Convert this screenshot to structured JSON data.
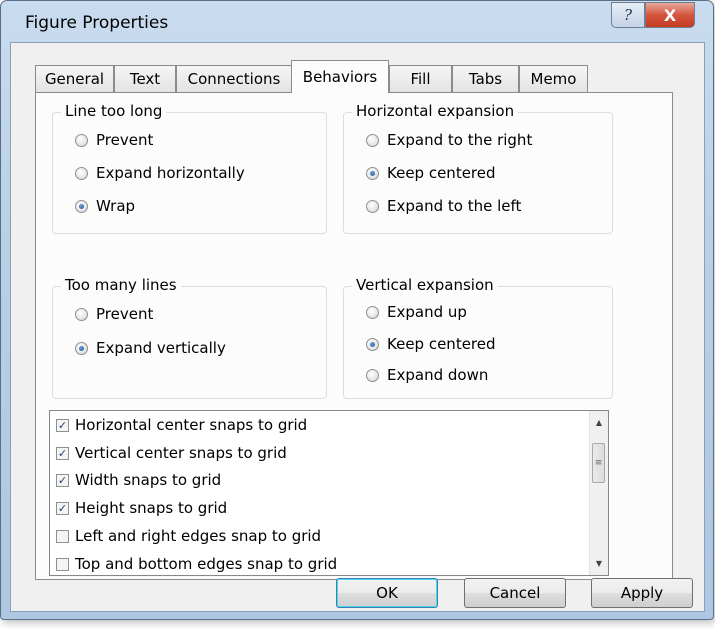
{
  "window": {
    "title": "Figure Properties",
    "help_glyph": "?",
    "close_glyph": "X"
  },
  "tabs": [
    {
      "label": "General"
    },
    {
      "label": "Text"
    },
    {
      "label": "Connections"
    },
    {
      "label": "Behaviors",
      "active": true
    },
    {
      "label": "Fill"
    },
    {
      "label": "Tabs"
    },
    {
      "label": "Memo"
    }
  ],
  "groups": {
    "line_too_long": {
      "title": "Line too long",
      "options": [
        "Prevent",
        "Expand horizontally",
        "Wrap"
      ],
      "selected": "Wrap"
    },
    "horizontal_expansion": {
      "title": "Horizontal expansion",
      "options": [
        "Expand to the right",
        "Keep centered",
        "Expand to the left"
      ],
      "selected": "Keep centered"
    },
    "too_many_lines": {
      "title": "Too many lines",
      "options": [
        "Prevent",
        "Expand vertically"
      ],
      "selected": "Expand vertically"
    },
    "vertical_expansion": {
      "title": "Vertical expansion",
      "options": [
        "Expand up",
        "Keep centered",
        "Expand down"
      ],
      "selected": "Keep centered"
    }
  },
  "snap_list": [
    {
      "label": "Horizontal center snaps to grid",
      "checked": true
    },
    {
      "label": "Vertical center snaps to grid",
      "checked": true
    },
    {
      "label": "Width snaps to grid",
      "checked": true
    },
    {
      "label": "Height snaps to grid",
      "checked": true
    },
    {
      "label": "Left and right edges snap to grid",
      "checked": false
    },
    {
      "label": "Top and bottom edges snap to grid",
      "checked": false
    }
  ],
  "buttons": {
    "ok": "OK",
    "cancel": "Cancel",
    "apply": "Apply"
  }
}
